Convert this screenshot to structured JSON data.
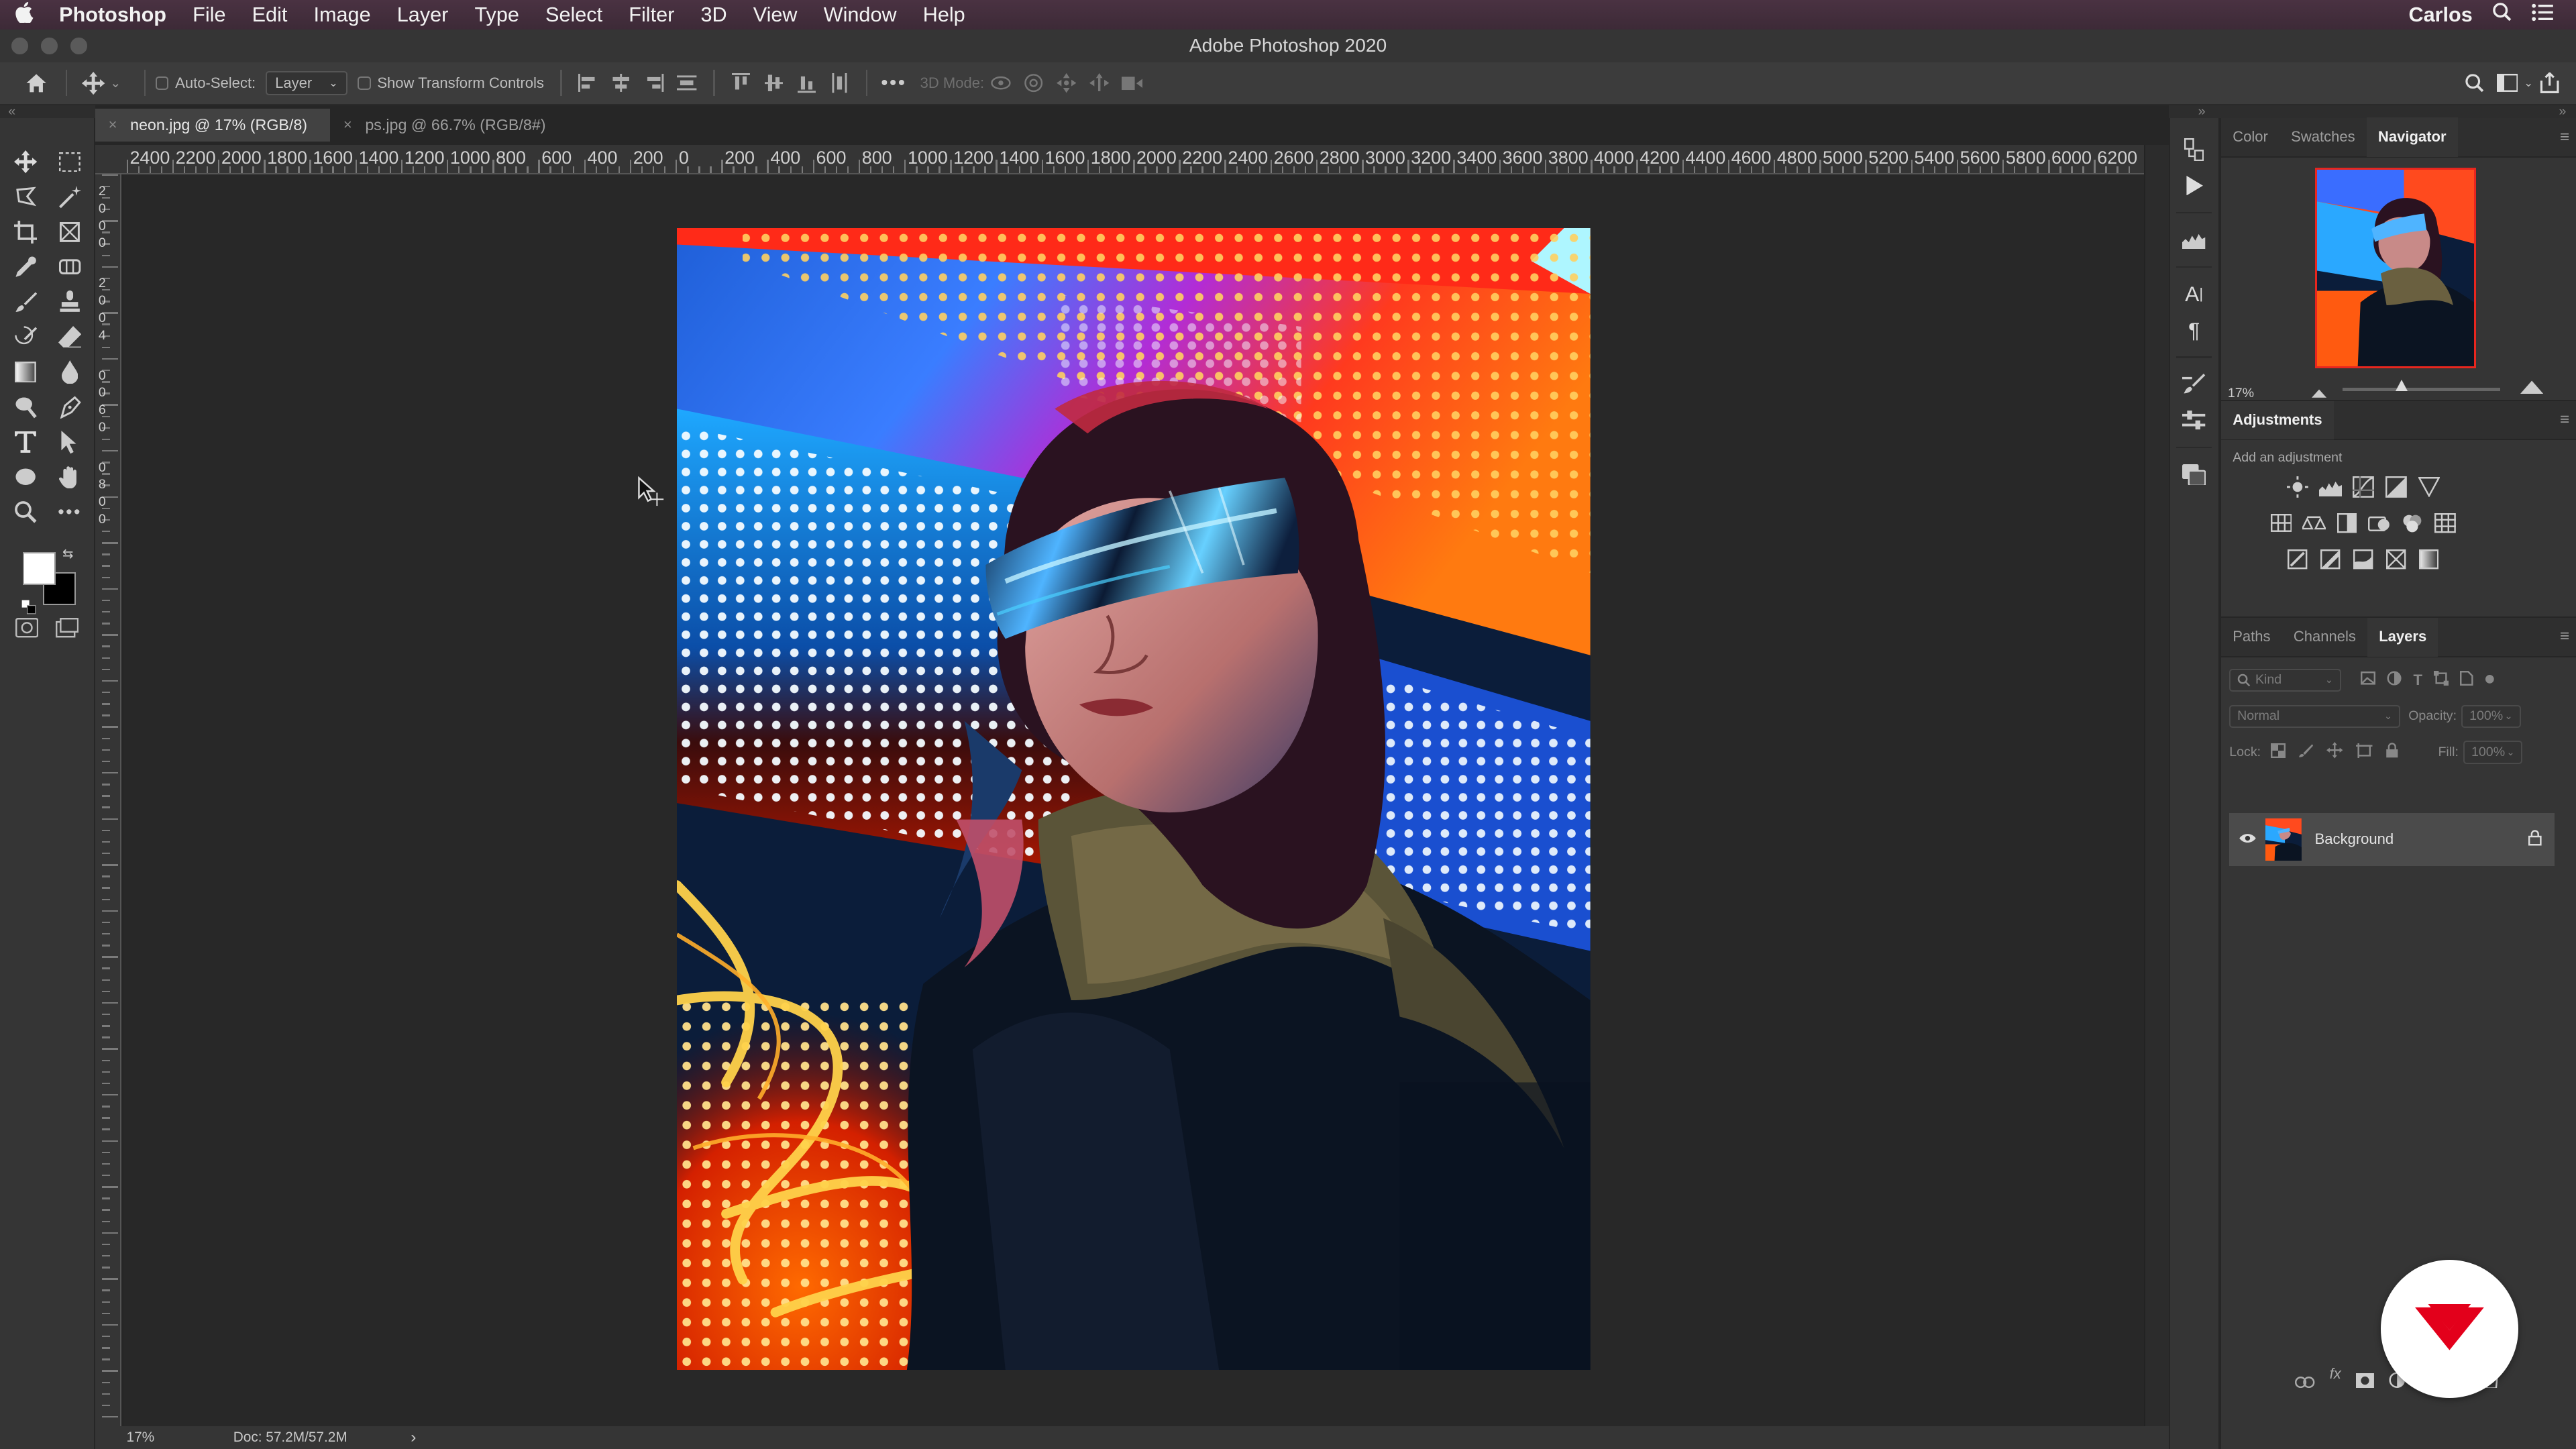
{
  "menubar": {
    "app": "Photoshop",
    "items": [
      "File",
      "Edit",
      "Image",
      "Layer",
      "Type",
      "Select",
      "Filter",
      "3D",
      "View",
      "Window",
      "Help"
    ],
    "user": "Carlos"
  },
  "window": {
    "title": "Adobe Photoshop 2020"
  },
  "options": {
    "auto_select_label": "Auto-Select:",
    "auto_select_target": "Layer",
    "transform_label": "Show Transform Controls",
    "mode_3d_label": "3D Mode:"
  },
  "tabs": [
    {
      "label": "neon.jpg @ 17% (RGB/8)",
      "active": true
    },
    {
      "label": "ps.jpg @ 66.7% (RGB/8#)",
      "active": false
    }
  ],
  "ruler": {
    "h_labels": [
      "2400",
      "2200",
      "2000",
      "1800",
      "1600",
      "1400",
      "1200",
      "1000",
      "800",
      "600",
      "400",
      "200",
      "0",
      "200",
      "400",
      "600",
      "800",
      "1000",
      "1200",
      "1400",
      "1600",
      "1800",
      "2000",
      "2200",
      "2400",
      "2600",
      "2800",
      "3000",
      "3200",
      "3400",
      "3600",
      "3800",
      "4000",
      "4200",
      "4400",
      "4600",
      "4800",
      "5000",
      "5200",
      "5400",
      "5600",
      "5800",
      "6000",
      "6200"
    ],
    "v_labels": [
      "2",
      "0",
      "0",
      "0",
      "2",
      "0",
      "0",
      "4",
      "0",
      "0",
      "6",
      "0",
      "0",
      "8",
      "0",
      "0"
    ]
  },
  "status": {
    "zoom": "17%",
    "doc": "Doc: 57.2M/57.2M"
  },
  "navigator": {
    "tabs": [
      "Color",
      "Swatches",
      "Navigator"
    ],
    "zoom": "17%"
  },
  "adjustments": {
    "title": "Adjustments",
    "hint": "Add an adjustment"
  },
  "layers": {
    "tabs": [
      "Paths",
      "Channels",
      "Layers"
    ],
    "filter_placeholder": "Kind",
    "blend_mode": "Normal",
    "opacity_label": "Opacity:",
    "opacity_value": "100%",
    "lock_label": "Lock:",
    "fill_label": "Fill:",
    "fill_value": "100%",
    "items": [
      {
        "name": "Background",
        "visible": true,
        "locked": true
      }
    ]
  },
  "colors": {
    "menubar": "#4a3242",
    "ui_dark": "#262626",
    "ui_panel": "#353535",
    "navigator_frame": "#e8261e",
    "badge_red": "#e3001b"
  }
}
